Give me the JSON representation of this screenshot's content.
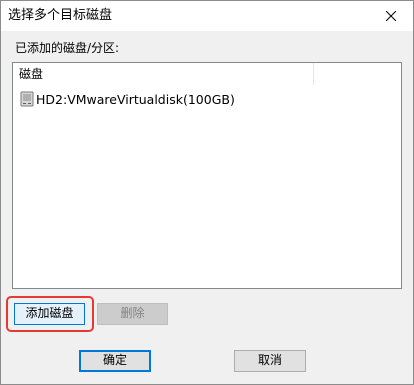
{
  "window": {
    "title": "选择多个目标磁盘",
    "close_icon": "close-icon"
  },
  "section": {
    "label": "已添加的磁盘/分区:"
  },
  "list": {
    "column_header": "磁盘",
    "rows": [
      {
        "icon": "disk-icon",
        "label": "HD2:VMwareVirtualdisk(100GB)"
      }
    ]
  },
  "buttons": {
    "add_label": "添加磁盘",
    "delete_label": "删除",
    "ok_label": "确定",
    "cancel_label": "取消"
  },
  "colors": {
    "highlight": "#e53935",
    "accent": "#0078d7"
  }
}
